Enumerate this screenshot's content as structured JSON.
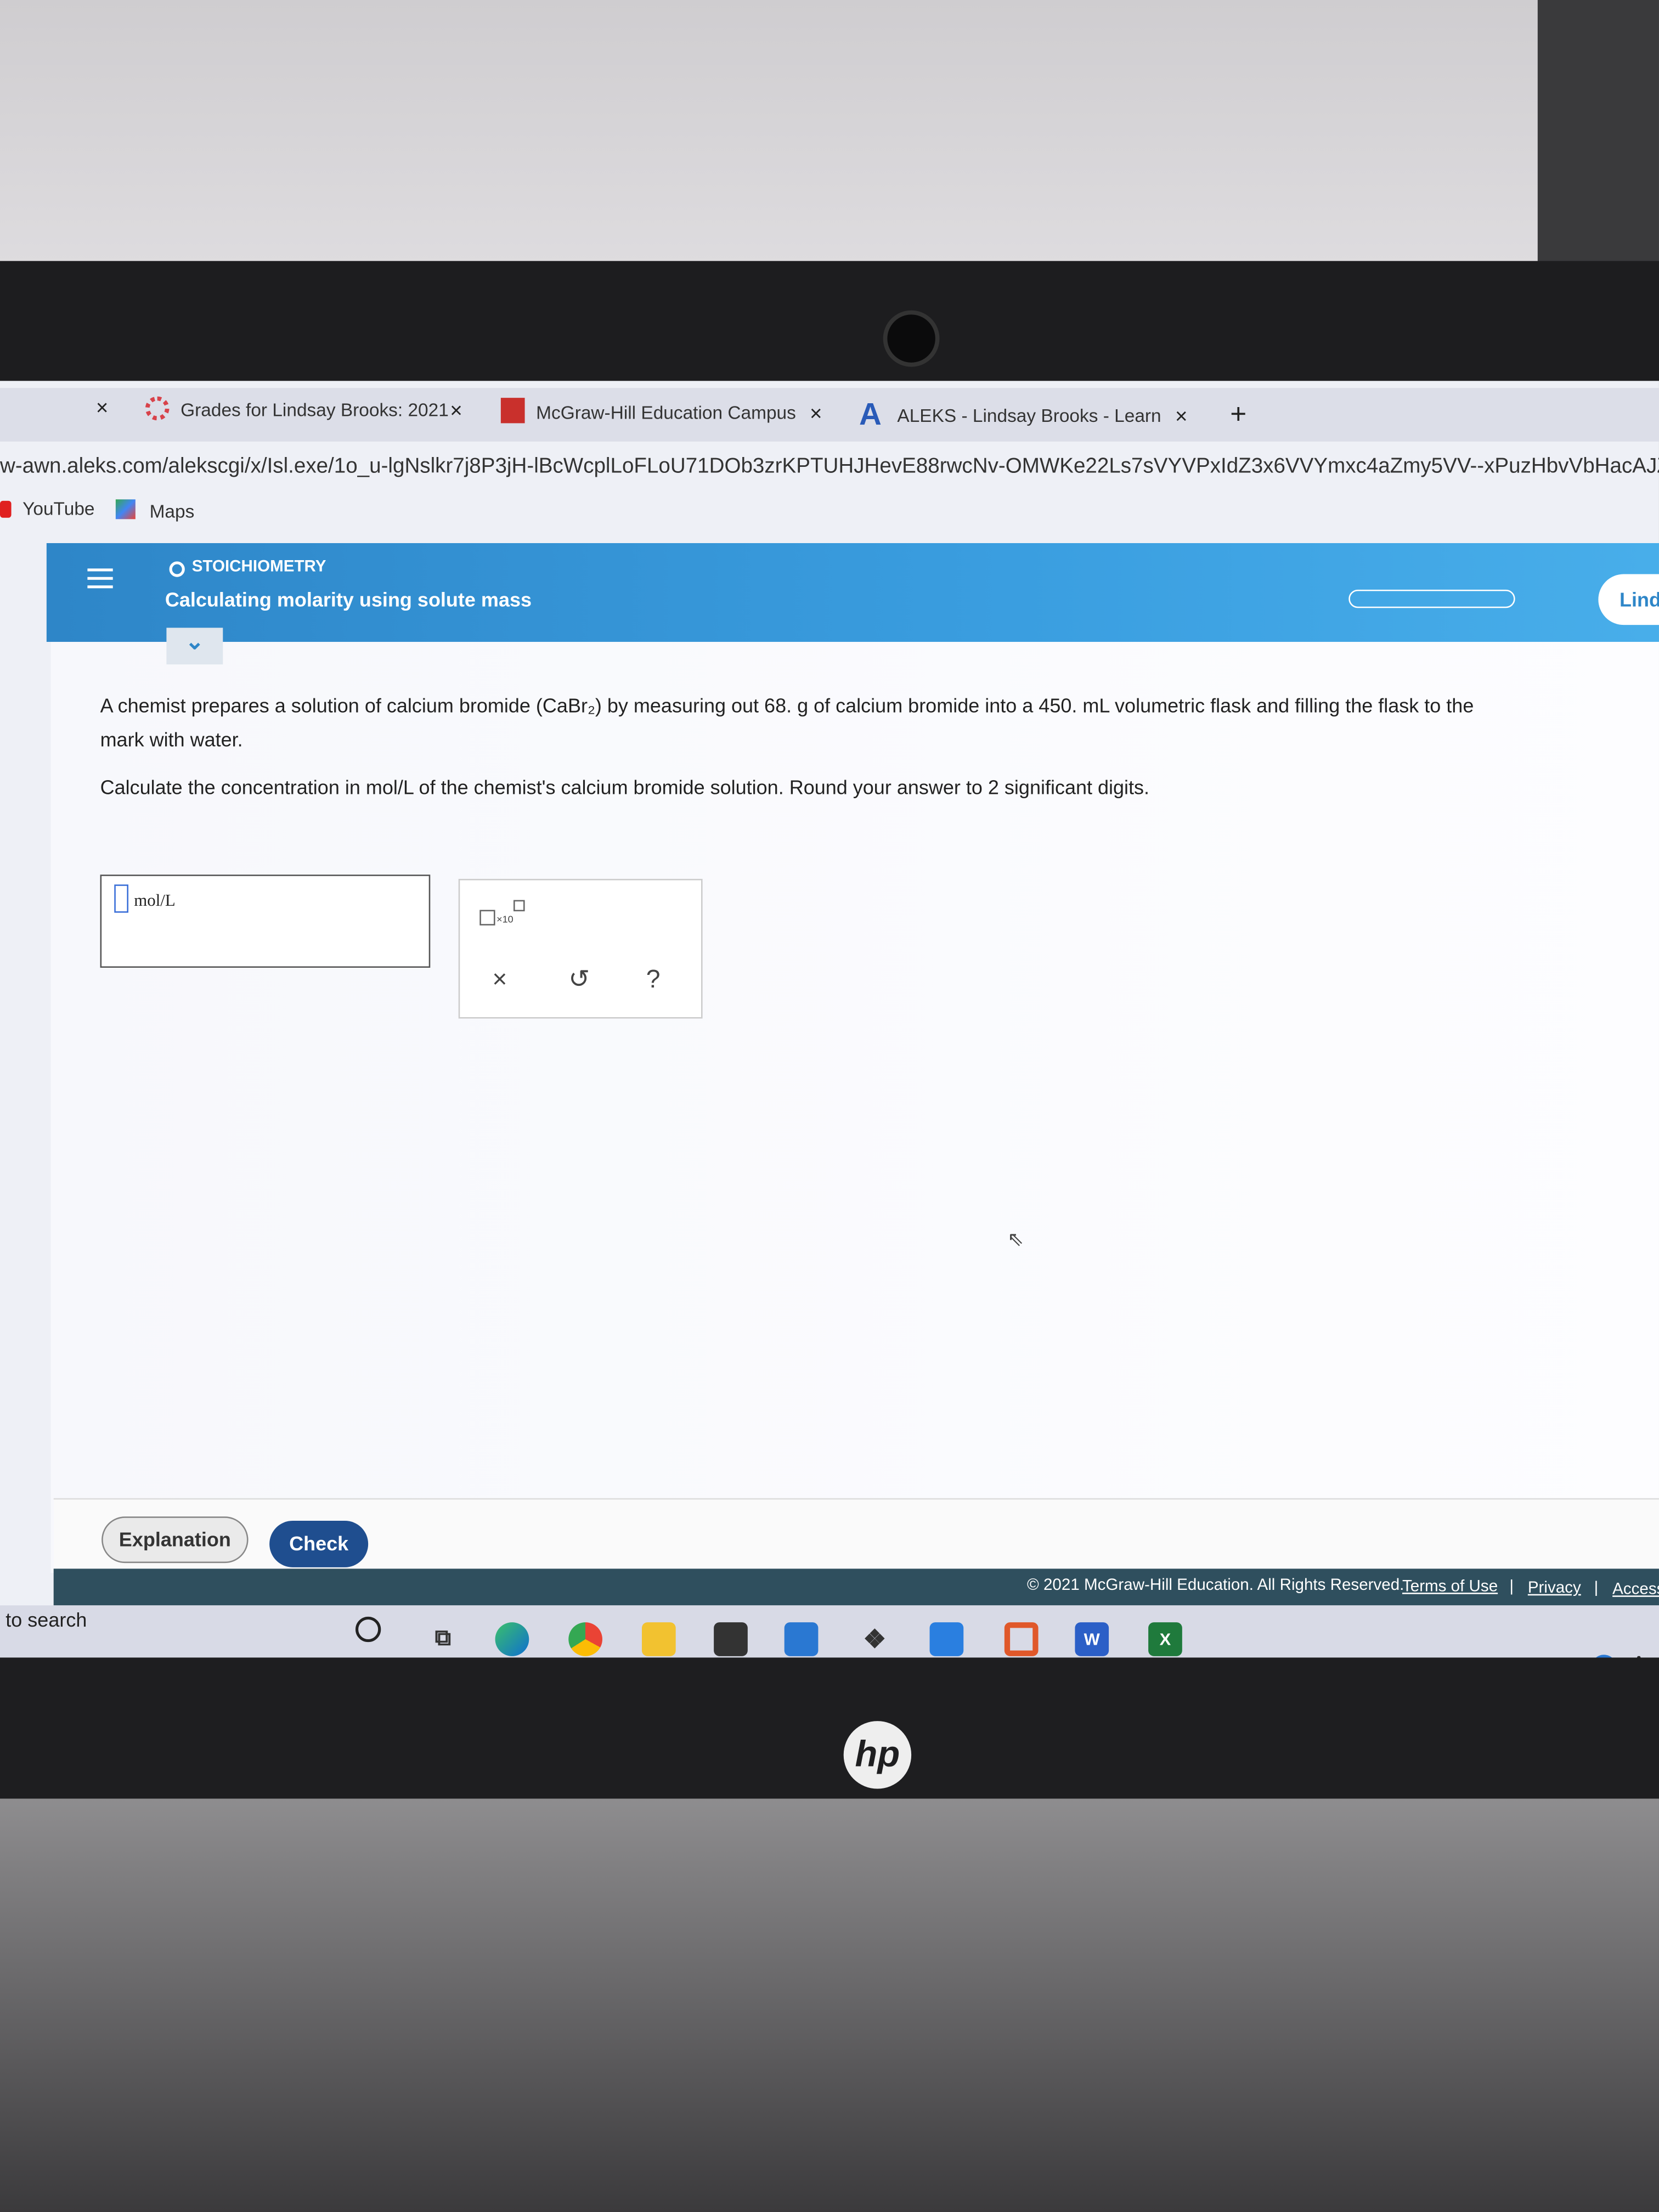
{
  "browser": {
    "tabs": [
      {
        "label": "Grades for Lindsay Brooks: 2021",
        "icon": "canvas-icon"
      },
      {
        "label": "McGraw-Hill Education Campus",
        "icon": "mcgraw-hill-icon"
      },
      {
        "label": "ALEKS - Lindsay Brooks - Learn",
        "icon": "aleks-a-icon"
      }
    ],
    "new_tab": "+",
    "close": "×",
    "url": "w-awn.aleks.com/alekscgi/x/Isl.exe/1o_u-lgNslkr7j8P3jH-lBcWcplLoFLoU71DOb3zrKPTUHJHevE88rwcNv-OMWKe22Ls7sVYVPxIdZ3x6VVYmxc4aZmy5VV--xPuzHbvVbHacAJZvKeo?",
    "bookmarks": [
      {
        "label": "YouTube"
      },
      {
        "label": "Maps"
      }
    ]
  },
  "aleks": {
    "topic": "STOICHIOMETRY",
    "title": "Calculating molarity using solute mass",
    "user": "Lind",
    "question": {
      "line1": "A chemist prepares a solution of calcium bromide (CaBr₂) by measuring out 68. g of calcium bromide into a 450. mL volumetric flask and filling the flask to the",
      "line2": "mark with water.",
      "line3": "Calculate the concentration in mol/L of the chemist's calcium bromide solution. Round your answer to 2 significant digits."
    },
    "answer": {
      "value": "",
      "unit": "mol/L"
    },
    "tools": {
      "sci": "×10",
      "clear": "×",
      "undo": "↺",
      "help": "?"
    },
    "buttons": {
      "explanation": "Explanation",
      "check": "Check"
    },
    "footer": {
      "copyright": "© 2021 McGraw-Hill Education. All Rights Reserved.",
      "links": [
        "Terms of Use",
        "Privacy",
        "Accessibility"
      ],
      "sep": "|"
    },
    "accent": "#2e86c8"
  },
  "taskbar": {
    "search": "to search",
    "icons": [
      "cortana-icon",
      "task-view-icon",
      "edge-icon",
      "chrome-icon",
      "file-explorer-icon",
      "store-icon",
      "mail-icon",
      "dropbox-icon",
      "power-automate-icon",
      "office-icon",
      "word-icon",
      "excel-icon"
    ],
    "word": "W",
    "excel": "X"
  },
  "laptop": {
    "brand": "hp"
  }
}
